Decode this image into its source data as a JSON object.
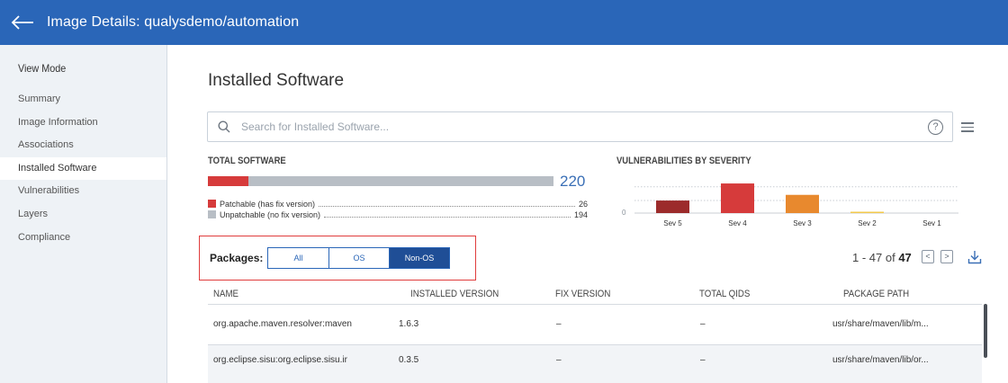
{
  "header": {
    "title": "Image Details: qualysdemo/automation"
  },
  "sidebar": {
    "heading": "View Mode",
    "items": [
      {
        "label": "Summary",
        "active": false
      },
      {
        "label": "Image Information",
        "active": false
      },
      {
        "label": "Associations",
        "active": false
      },
      {
        "label": "Installed Software",
        "active": true
      },
      {
        "label": "Vulnerabilities",
        "active": false
      },
      {
        "label": "Layers",
        "active": false
      },
      {
        "label": "Compliance",
        "active": false
      }
    ]
  },
  "main": {
    "title": "Installed Software",
    "search": {
      "placeholder": "Search for Installed Software...",
      "value": ""
    },
    "help_glyph": "?",
    "total_software": {
      "label": "TOTAL SOFTWARE",
      "total": "220",
      "patchable": {
        "label": "Patchable (has fix version)",
        "value": "26",
        "color": "#d63b3b"
      },
      "unpatchable": {
        "label": "Unpatchable (no fix version)",
        "value": "194",
        "color": "#b8bec5"
      }
    },
    "severity": {
      "label": "VULNERABILITIES BY SEVERITY",
      "axis_zero": "0"
    },
    "packages": {
      "label": "Packages:",
      "options": [
        "All",
        "OS",
        "Non-OS"
      ],
      "selected": "Non-OS"
    },
    "pager": {
      "range": "1 - 47 of",
      "total": "47",
      "prev_glyph": "<",
      "next_glyph": ">"
    },
    "table": {
      "columns": [
        "NAME",
        "INSTALLED VERSION",
        "FIX VERSION",
        "TOTAL QIDS",
        "PACKAGE PATH"
      ],
      "rows": [
        [
          "org.apache.maven.resolver:maven",
          "1.6.3",
          "–",
          "–",
          "usr/share/maven/lib/m..."
        ],
        [
          "org.eclipse.sisu:org.eclipse.sisu.ir",
          "0.3.5",
          "–",
          "–",
          "usr/share/maven/lib/or..."
        ]
      ]
    }
  },
  "chart_data": {
    "type": "bar",
    "title": "VULNERABILITIES BY SEVERITY",
    "categories": [
      "Sev 5",
      "Sev 4",
      "Sev 3",
      "Sev 2",
      "Sev 1"
    ],
    "values": [
      11,
      26,
      16,
      1,
      0
    ],
    "colors": [
      "#9c2b2b",
      "#d63b3b",
      "#e8892e",
      "#f2c94c",
      "#a9c4e8"
    ],
    "ylim": [
      0,
      30
    ],
    "grid": true
  }
}
